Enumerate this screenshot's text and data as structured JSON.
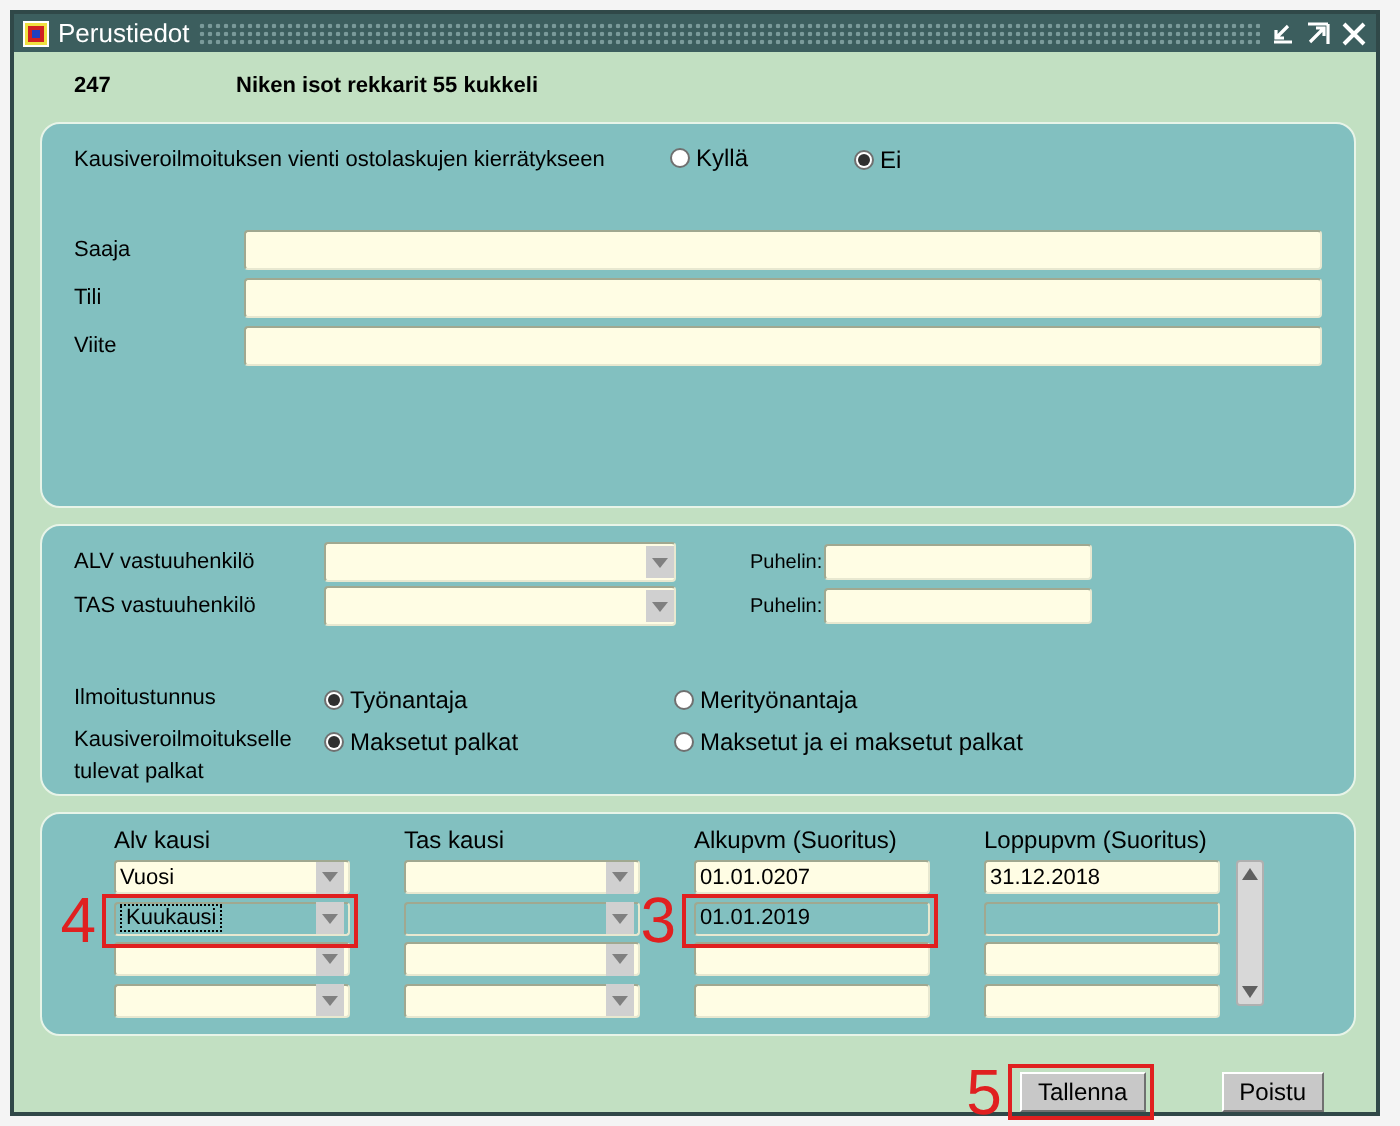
{
  "window": {
    "title": "Perustiedot"
  },
  "header": {
    "number": "247",
    "name": "Niken isot rekkarit 55 kukkeli"
  },
  "export": {
    "label": "Kausiveroilmoituksen vienti ostolaskujen kierrätykseen",
    "options": [
      {
        "label": "Kyllä",
        "selected": false
      },
      {
        "label": "Ei",
        "selected": true
      }
    ]
  },
  "recipient_fields": [
    {
      "label": "Saaja"
    },
    {
      "label": "Tili"
    },
    {
      "label": "Viite"
    }
  ],
  "contacts": [
    {
      "label": "ALV vastuuhenkilö",
      "phone_label": "Puhelin:"
    },
    {
      "label": "TAS vastuuhenkilö",
      "phone_label": "Puhelin:"
    }
  ],
  "radio_groups": [
    {
      "label": "Ilmoitustunnus",
      "options": [
        {
          "label": "Työnantaja",
          "selected": true
        },
        {
          "label": "Merityönantaja",
          "selected": false
        }
      ]
    },
    {
      "label": "Kausiveroilmoitukselle tulevat palkat",
      "options": [
        {
          "label": "Maksetut palkat",
          "selected": true
        },
        {
          "label": "Maksetut ja ei maksetut palkat",
          "selected": false
        }
      ]
    }
  ],
  "periods": {
    "columns": [
      {
        "label": "Alv kausi",
        "kind": "combo"
      },
      {
        "label": "Tas kausi",
        "kind": "combo"
      },
      {
        "label": "Alkupvm (Suoritus)",
        "kind": "text"
      },
      {
        "label": "Loppupvm (Suoritus)",
        "kind": "text"
      }
    ],
    "rows": [
      {
        "selected": false,
        "cells": [
          {
            "value": "Vuosi"
          },
          {},
          {
            "value": "01.01.0207"
          },
          {
            "value": "31.12.2018"
          }
        ]
      },
      {
        "selected": true,
        "cells": [
          {
            "value": "Kuukausi",
            "focused": true,
            "annotation": "4"
          },
          {},
          {
            "value": "01.01.2019",
            "annotation": "3"
          },
          {}
        ]
      },
      {
        "selected": false,
        "cells": [
          {},
          {},
          {},
          {}
        ]
      },
      {
        "selected": false,
        "cells": [
          {},
          {},
          {},
          {}
        ]
      }
    ]
  },
  "buttons": [
    {
      "label": "Tallenna",
      "annotation": "5"
    },
    {
      "label": "Poistu"
    }
  ]
}
